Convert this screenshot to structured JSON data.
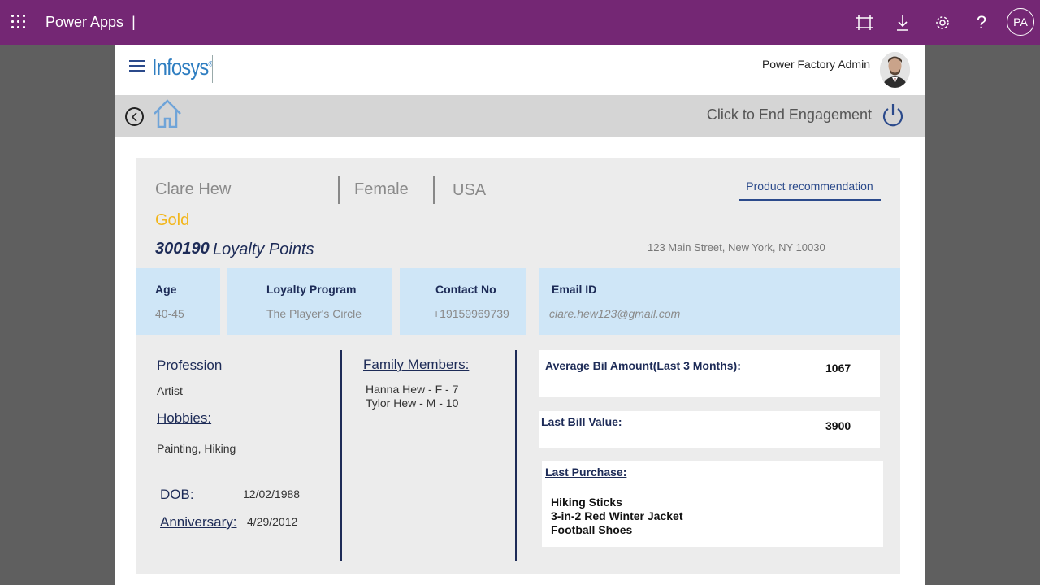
{
  "topbar": {
    "app_name": "Power Apps",
    "initials": "PA",
    "icons": [
      "waffle-icon",
      "fit-screen-icon",
      "download-icon",
      "settings-icon",
      "help-icon"
    ]
  },
  "header": {
    "logo_text": "Infosys",
    "logo_mark": "®",
    "user_name": "Power Factory Admin"
  },
  "nav": {
    "end_engagement": "Click to End Engagement"
  },
  "customer": {
    "name": "Clare Hew",
    "gender": "Female",
    "country": "USA",
    "product_recommendation": "Product recommendation",
    "tier": "Gold",
    "points": "300190",
    "points_label": "Loyalty Points",
    "address": "123 Main Street, New York, NY 10030",
    "age_label": "Age",
    "age_value": "40-45",
    "program_label": "Loyalty Program",
    "program_value": "The Player's Circle",
    "contact_label": "Contact No",
    "contact_value": "+19159969739",
    "email_label": "Email ID",
    "email_value": "clare.hew123@gmail.com",
    "profession_label": "Profession",
    "profession_value": "Artist",
    "hobbies_label": "Hobbies:",
    "hobbies_value": "Painting, Hiking",
    "dob_label": "DOB:",
    "dob_value": "12/02/1988",
    "anniversary_label": "Anniversary:",
    "anniversary_value": "4/29/2012",
    "family_label": "Family Members:",
    "family_members": [
      "Hanna Hew - F - 7",
      "Tylor Hew - M - 10"
    ],
    "avg_bill_label": "Average Bil Amount(Last 3 Months):",
    "avg_bill_value": "1067",
    "last_bill_label": "Last Bill Value:",
    "last_bill_value": "3900",
    "last_purchase_label": "Last Purchase:",
    "last_purchase_items": [
      "Hiking Sticks",
      "3-in-2 Red Winter Jacket",
      "Football Shoes"
    ]
  },
  "colors": {
    "topbar": "#742774",
    "accent_blue": "#2b4a8b",
    "tier_gold": "#f2b61c",
    "info_box": "#cfe6f7",
    "card_bg": "#ececec"
  }
}
